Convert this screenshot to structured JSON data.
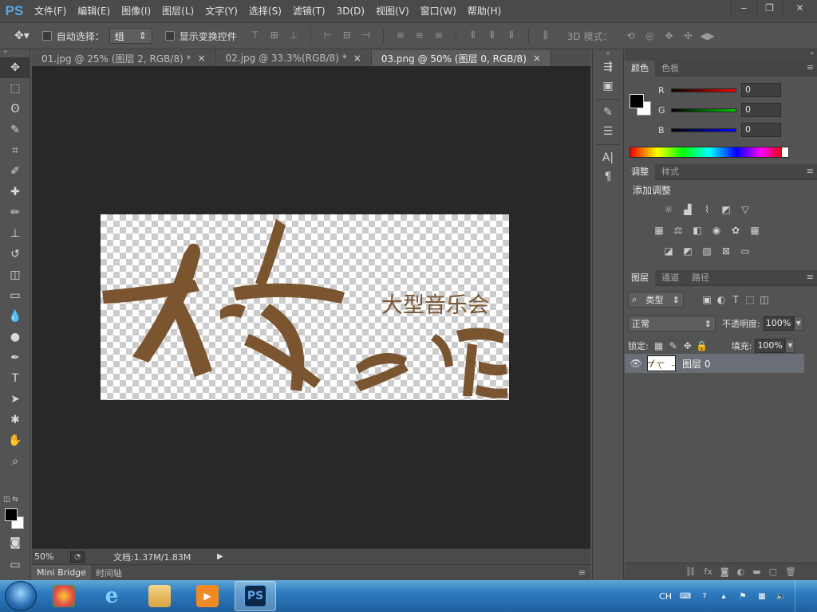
{
  "app": {
    "logo": "PS",
    "menu": [
      "文件(F)",
      "编辑(E)",
      "图像(I)",
      "图层(L)",
      "文字(Y)",
      "选择(S)",
      "滤镜(T)",
      "3D(D)",
      "视图(V)",
      "窗口(W)",
      "帮助(H)"
    ],
    "window_controls": {
      "minimize": "‒",
      "restore": "❐",
      "close": "✕"
    }
  },
  "options_bar": {
    "auto_select_label": "自动选择：",
    "group_select_value": "组",
    "show_transform_label": "显示变换控件",
    "mode_3d_label": "3D 模式："
  },
  "tools": [
    {
      "name": "move-tool",
      "glyph": "✥"
    },
    {
      "name": "marquee-tool",
      "glyph": "⬚"
    },
    {
      "name": "lasso-tool",
      "glyph": "ʘ"
    },
    {
      "name": "quick-select-tool",
      "glyph": "✎"
    },
    {
      "name": "crop-tool",
      "glyph": "⌗"
    },
    {
      "name": "eyedropper-tool",
      "glyph": "✐"
    },
    {
      "name": "healing-brush-tool",
      "glyph": "✚"
    },
    {
      "name": "brush-tool",
      "glyph": "✏"
    },
    {
      "name": "stamp-tool",
      "glyph": "⊥"
    },
    {
      "name": "history-brush-tool",
      "glyph": "↺"
    },
    {
      "name": "eraser-tool",
      "glyph": "◫"
    },
    {
      "name": "gradient-tool",
      "glyph": "▭"
    },
    {
      "name": "blur-tool",
      "glyph": "💧"
    },
    {
      "name": "dodge-tool",
      "glyph": "●"
    },
    {
      "name": "pen-tool",
      "glyph": "✒"
    },
    {
      "name": "type-tool",
      "glyph": "T"
    },
    {
      "name": "path-select-tool",
      "glyph": "➤"
    },
    {
      "name": "shape-tool",
      "glyph": "✱"
    },
    {
      "name": "hand-tool",
      "glyph": "✋"
    },
    {
      "name": "zoom-tool",
      "glyph": "⌕"
    }
  ],
  "documents": {
    "tabs": [
      {
        "label": "01.jpg @ 25% (图层 2, RGB/8) *",
        "active": false
      },
      {
        "label": "02.jpg @ 33.3%(RGB/8) *",
        "active": false
      },
      {
        "label": "03.png @ 50% (图层 0, RGB/8)",
        "active": true
      }
    ],
    "close_glyph": "×"
  },
  "artwork": {
    "subtitle": "大型音乐会",
    "ink_color": "#7a5530"
  },
  "status": {
    "zoom": "50%",
    "doc_size": "文档:1.37M/1.83M",
    "arrow": "▶"
  },
  "bottom_tabs": [
    "Mini Bridge",
    "时间轴"
  ],
  "color_panel": {
    "tabs": [
      "颜色",
      "色板"
    ],
    "sliders": [
      {
        "label": "R",
        "value": "0",
        "gradient": "linear-gradient(90deg,#000,#f00)"
      },
      {
        "label": "G",
        "value": "0",
        "gradient": "linear-gradient(90deg,#000,#0c0)"
      },
      {
        "label": "B",
        "value": "0",
        "gradient": "linear-gradient(90deg,#000,#00f)"
      }
    ]
  },
  "adjust_panel": {
    "tabs": [
      "调整",
      "样式"
    ],
    "title": "添加调整"
  },
  "layers_panel": {
    "tabs": [
      "图层",
      "通道",
      "路径"
    ],
    "filter_type": "类型",
    "blend_mode": "正常",
    "opacity_label": "不透明度:",
    "opacity_value": "100%",
    "lock_label": "锁定:",
    "fill_label": "填充:",
    "fill_value": "100%",
    "layer_name": "图层 0"
  },
  "taskbar": {
    "language": "CH"
  }
}
